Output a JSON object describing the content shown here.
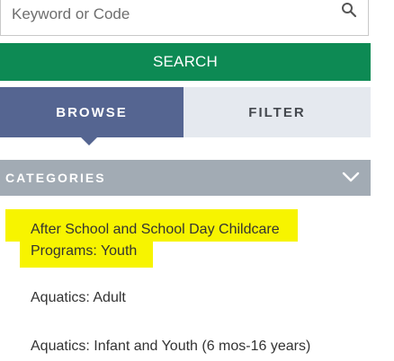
{
  "search": {
    "placeholder": "Keyword or Code",
    "button_label": "SEARCH",
    "icon": "search-icon"
  },
  "tabs": [
    {
      "label": "BROWSE",
      "active": true
    },
    {
      "label": "FILTER",
      "active": false
    }
  ],
  "categories": {
    "header": "CATEGORIES",
    "chevron_icon": "chevron-down-icon",
    "items": [
      {
        "label_line1": "After School and School Day Childcare",
        "label_line2": "Programs: Youth",
        "highlighted": true
      },
      {
        "label": "Aquatics: Adult"
      },
      {
        "label": "Aquatics: Infant and Youth (6 mos-16 years)"
      }
    ]
  },
  "colors": {
    "search_button": "#0d8a54",
    "tab_active": "#556591",
    "tab_inactive": "#e5e9ef",
    "category_header": "#a2abb4",
    "highlight": "#f7f400"
  }
}
